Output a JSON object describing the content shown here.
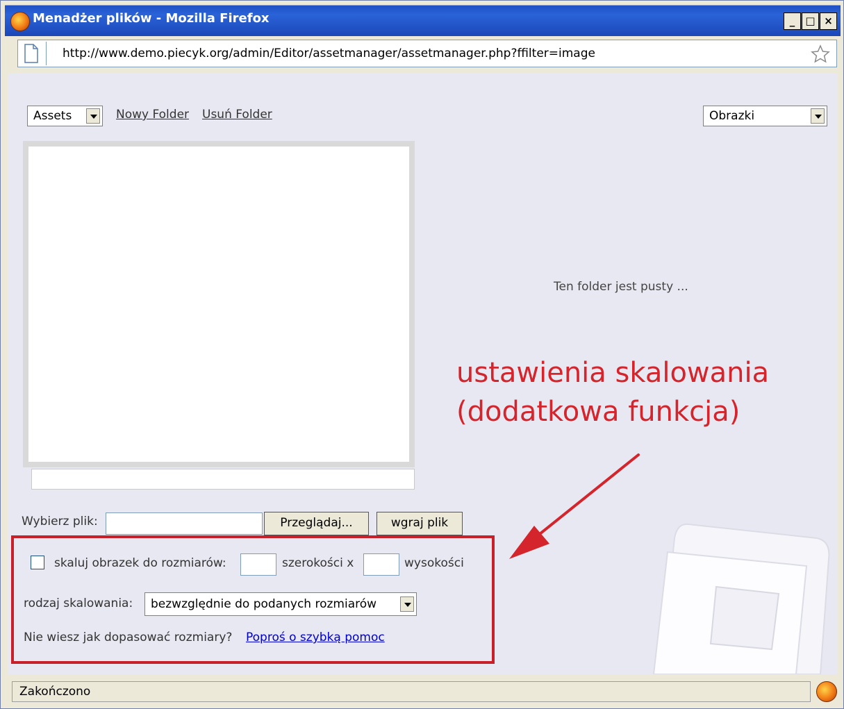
{
  "window": {
    "title": "Menadżer plików - Mozilla Firefox",
    "controls": {
      "minimize": "_",
      "maximize": "□",
      "close": "×"
    }
  },
  "address": {
    "url": "http://www.demo.piecyk.org/admin/Editor/assetmanager/assetmanager.php?ffilter=image"
  },
  "toolbar": {
    "folder_select": "Assets",
    "new_folder": "Nowy Folder",
    "delete_folder": "Usuń Folder",
    "filter_select": "Obrazki"
  },
  "preview": {
    "empty_message": "Ten folder jest pusty ..."
  },
  "annotation": {
    "line1": "ustawienia skalowania",
    "line2": "(dodatkowa funkcja)",
    "color": "#d4242c"
  },
  "upload": {
    "label": "Wybierz plik:",
    "browse_button": "Przeglądaj...",
    "upload_button": "wgraj plik"
  },
  "scaling": {
    "checkbox_label": "skaluj obrazek do rozmiarów:",
    "width_label": "szerokości x",
    "height_label": "wysokości",
    "mode_label": "rodzaj skalowania:",
    "mode_value": "bezwzględnie do podanych rozmiarów",
    "help_prompt": "Nie wiesz jak dopasować rozmiary?",
    "help_link": "Poproś o szybką pomoc",
    "box_color": "#c8202a"
  },
  "status": {
    "text": "Zakończono"
  },
  "icons": [
    "firefox-icon",
    "page-icon",
    "bookmark-star-icon",
    "dropdown-arrow-icon",
    "folder-illustration-icon"
  ]
}
